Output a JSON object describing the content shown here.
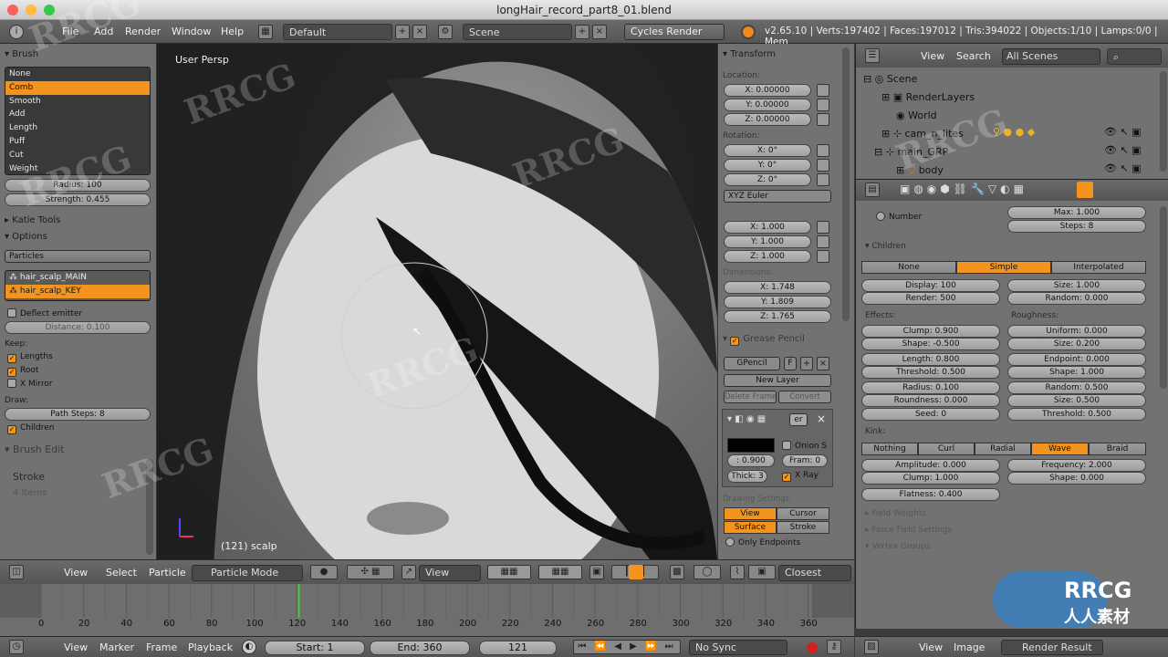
{
  "window": {
    "title": "longHair_record_part8_01.blend"
  },
  "header": {
    "menus": [
      "File",
      "Add",
      "Render",
      "Window",
      "Help"
    ],
    "layout": "Default",
    "scene": "Scene",
    "render_engine": "Cycles Render",
    "stats": "v2.65.10 | Verts:197402 | Faces:197012 | Tris:394022 | Objects:1/10 | Lamps:0/0 | Mem"
  },
  "toolshelf": {
    "brush_header": "Brush",
    "brushes": [
      "None",
      "Comb",
      "Smooth",
      "Add",
      "Length",
      "Puff",
      "Cut",
      "Weight"
    ],
    "selected_brush": "Comb",
    "radius": "Radius: 100",
    "strength": "Strength: 0.455",
    "katie_tools": "Katie Tools",
    "options": "Options",
    "mode_select": "Particles",
    "particle_systems": [
      "hair_scalp_MAIN",
      "hair_scalp_KEY"
    ],
    "deflect": "Deflect emitter",
    "distance": "Distance: 0.100",
    "keep_label": "Keep:",
    "keep_lengths": "Lengths",
    "keep_root": "Root",
    "x_mirror": "X Mirror",
    "draw_label": "Draw:",
    "path_steps": "Path Steps: 8",
    "children": "Children",
    "brush_edit": "Brush Edit",
    "stroke": "Stroke",
    "items": "4 Items"
  },
  "viewport": {
    "label": "User Persp",
    "object_label": "(121) scalp"
  },
  "npanel": {
    "transform": "Transform",
    "location": "Location:",
    "loc": [
      "X: 0.00000",
      "Y: 0.00000",
      "Z: 0.00000"
    ],
    "rotation": "Rotation:",
    "rot": [
      "X: 0°",
      "Y: 0°",
      "Z: 0°"
    ],
    "euler": "XYZ Euler",
    "scale": [
      "X: 1.000",
      "Y: 1.000",
      "Z: 1.000"
    ],
    "dimensions_label": "Dimensions:",
    "dim": [
      "X: 1.748",
      "Y: 1.809",
      "Z: 1.765"
    ],
    "grease_pencil": "Grease Pencil",
    "gpencil": "GPencil",
    "gpencil_f": "F",
    "new_layer": "New Layer",
    "delete_frame": "Delete Frame",
    "convert": "Convert",
    "layer_name": "er",
    "opacity": ": 0.900",
    "onion": "Onion S",
    "frames": "Fram: 0",
    "thick": "Thick: 3",
    "xray": "X Ray",
    "drawing_settings": "Drawing Settings:",
    "view": "View",
    "cursor": "Cursor",
    "surface": "Surface",
    "stroke": "Stroke",
    "only_endpoints": "Only Endpoints"
  },
  "outliner": {
    "menus": [
      "View",
      "Search"
    ],
    "scenes": "All Scenes",
    "items": [
      "Scene",
      "RenderLayers",
      "World",
      "cam_n_lites",
      "main_GRP",
      "body"
    ]
  },
  "properties": {
    "number": "Number",
    "max": "Max: 1.000",
    "steps": "Steps: 8",
    "children_header": "Children",
    "child_tabs": [
      "None",
      "Simple",
      "Interpolated"
    ],
    "child_selected": "Simple",
    "display": "Display: 100",
    "render": "Render: 500",
    "size": "Size: 1.000",
    "random": "Random: 0.000",
    "effects": "Effects:",
    "roughness": "Roughness:",
    "left_col": [
      "Clump: 0.900",
      "Shape: -0.500",
      "Length: 0.800",
      "Threshold: 0.500",
      "Radius: 0.100",
      "Roundness: 0.000",
      "Seed: 0"
    ],
    "right_col": [
      "Uniform: 0.000",
      "Size: 0.200",
      "Endpoint: 0.000",
      "Shape: 1.000",
      "Random: 0.500",
      "Size: 0.500",
      "Threshold: 0.500"
    ],
    "kink": "Kink:",
    "kink_tabs": [
      "Nothing",
      "Curl",
      "Radial",
      "Wave",
      "Braid"
    ],
    "kink_selected": "Wave",
    "amplitude": "Amplitude: 0.000",
    "clump": "Clump: 1.000",
    "frequency": "Frequency: 2.000",
    "shape": "Shape: 0.000",
    "flatness": "Flatness: 0.400",
    "field_weights": "Field Weights",
    "force_field": "Force Field Settings",
    "vertex_groups": "Vertex Groups"
  },
  "viewport_header": {
    "menus": [
      "View",
      "Select",
      "Particle"
    ],
    "mode": "Particle Mode",
    "view": "View",
    "closest": "Closest"
  },
  "timeline": {
    "ticks": [
      "0",
      "20",
      "40",
      "60",
      "80",
      "100",
      "120",
      "140",
      "160",
      "180",
      "200",
      "220",
      "240",
      "260",
      "280",
      "300",
      "320",
      "340",
      "360"
    ],
    "current_frame": 121,
    "end": 360
  },
  "timeline_header": {
    "menus": [
      "View",
      "Marker",
      "Frame",
      "Playback"
    ],
    "start": "Start: 1",
    "end": "End: 360",
    "current": "121",
    "sync": "No Sync"
  },
  "image_header": {
    "menus": [
      "View",
      "Image"
    ],
    "image": "Render Result"
  },
  "watermark": "RRCG",
  "watermark_cn": "人人素材"
}
